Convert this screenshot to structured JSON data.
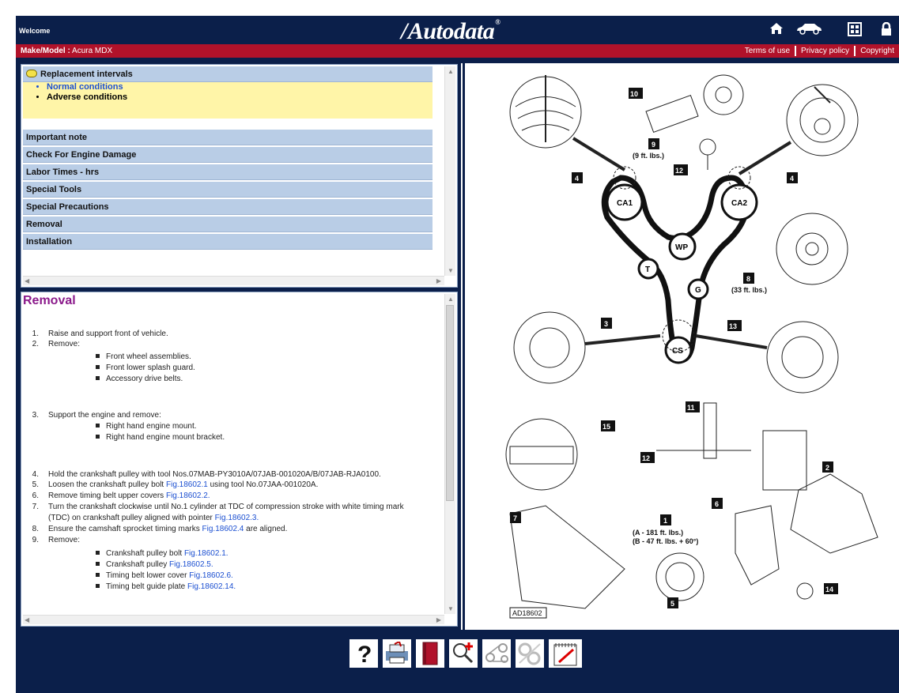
{
  "header": {
    "welcome": "Welcome",
    "logo": "Autodata",
    "icons": [
      "home-icon",
      "car-icon",
      "grid-icon",
      "lock-icon"
    ]
  },
  "bar": {
    "make_model_label": "Make/Model :",
    "make_model_value": "Acura MDX",
    "links": [
      "Terms of use",
      "Privacy policy",
      "Copyright"
    ]
  },
  "toc": {
    "head": "Replacement intervals",
    "subs": [
      "Normal conditions",
      "Adverse conditions"
    ],
    "items": [
      "Important note",
      "Check For Engine Damage",
      "Labor Times - hrs",
      "Special Tools",
      "Special Precautions",
      "Removal",
      "Installation"
    ]
  },
  "content": {
    "title": "Removal",
    "s1": "Raise and support front of vehicle.",
    "s2": "Remove:",
    "b2": [
      "Front wheel assemblies.",
      "Front lower splash guard.",
      "Accessory drive belts."
    ],
    "s3": "Support the engine and remove:",
    "b3": [
      "Right hand engine mount.",
      "Right hand engine mount bracket."
    ],
    "s4": "Hold the crankshaft pulley with tool Nos.07MAB-PY3010A/07JAB-001020A/B/07JAB-RJA0100.",
    "s5a": "Loosen the crankshaft pulley bolt",
    "s5link": "Fig.18602.1",
    "s5b": "using tool No.07JAA-001020A.",
    "s6a": "Remove timing belt upper covers",
    "s6link": "Fig.18602.2.",
    "s7a": "Turn the crankshaft clockwise until No.1 cylinder at TDC of compression stroke with white timing mark",
    "s7b": "(TDC) on crankshaft pulley aligned with pointer",
    "s7link": "Fig.18602.3.",
    "s8a": "Ensure the camshaft sprocket timing marks",
    "s8link": "Fig.18602.4",
    "s8b": "are aligned.",
    "s9": "Remove:",
    "b9": [
      {
        "text": "Crankshaft pulley bolt",
        "link": "Fig.18602.1."
      },
      {
        "text": "Crankshaft pulley",
        "link": "Fig.18602.5."
      },
      {
        "text": "Timing belt lower cover",
        "link": "Fig.18602.6."
      },
      {
        "text": "Timing belt guide plate",
        "link": "Fig.18602.14."
      }
    ]
  },
  "diagram": {
    "labels": {
      "ca1": "CA1",
      "ca2": "CA2",
      "wp": "WP",
      "t": "T",
      "g": "G",
      "cs": "CS",
      "n1": "1",
      "n2": "2",
      "n3": "3",
      "n4": "4",
      "n5": "5",
      "n6": "6",
      "n7": "7",
      "n8": "8",
      "n9": "9",
      "n10": "10",
      "n11": "11",
      "n12": "12",
      "n13": "13",
      "n14": "14",
      "n15": "15",
      "t9": "(9 ft. lbs.)",
      "t8": "(33 ft. lbs.)",
      "t1a": "(A - 181 ft. lbs.)",
      "t1b": "(B - 47 ft. lbs. + 60°)",
      "code": "AD18602"
    }
  },
  "toolbar": {
    "icons": [
      "help-icon",
      "print-icon",
      "book-icon",
      "zoom-icon",
      "belt-icon",
      "gears-icon",
      "notepad-icon"
    ]
  }
}
